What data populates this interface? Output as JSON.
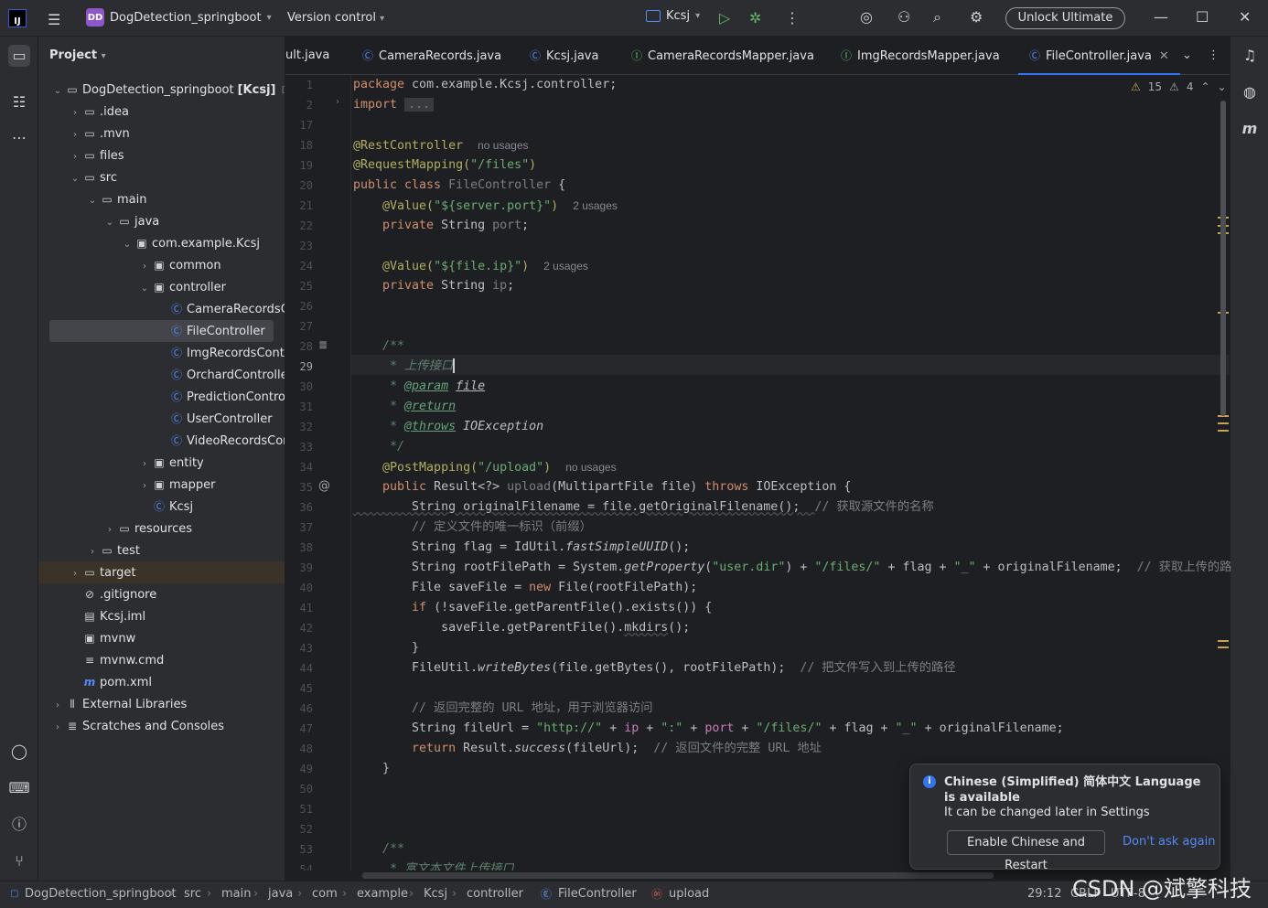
{
  "titlebar": {
    "logo": "IJ",
    "project_badge": "DD",
    "project_name": "DogDetection_springboot",
    "version_control": "Version control",
    "run_config": "Kcsj",
    "unlock": "Unlock Ultimate"
  },
  "project_panel": {
    "title": "Project",
    "tree": [
      {
        "label": "DogDetection_springboot",
        "extra": "[Kcsj]",
        "path": "D:\\I",
        "indent": 0,
        "arrow": "down",
        "icon": "module"
      },
      {
        "label": ".idea",
        "indent": 1,
        "arrow": "right",
        "icon": "folder"
      },
      {
        "label": ".mvn",
        "indent": 1,
        "arrow": "right",
        "icon": "folder"
      },
      {
        "label": "files",
        "indent": 1,
        "arrow": "right",
        "icon": "folder"
      },
      {
        "label": "src",
        "indent": 1,
        "arrow": "down",
        "icon": "folder"
      },
      {
        "label": "main",
        "indent": 2,
        "arrow": "down",
        "icon": "folder"
      },
      {
        "label": "java",
        "indent": 3,
        "arrow": "down",
        "icon": "folder"
      },
      {
        "label": "com.example.Kcsj",
        "indent": 4,
        "arrow": "down",
        "icon": "package"
      },
      {
        "label": "common",
        "indent": 5,
        "arrow": "right",
        "icon": "package"
      },
      {
        "label": "controller",
        "indent": 5,
        "arrow": "down",
        "icon": "package"
      },
      {
        "label": "CameraRecordsController",
        "indent": 6,
        "arrow": "",
        "icon": "class"
      },
      {
        "label": "FileController",
        "indent": 6,
        "arrow": "",
        "icon": "class",
        "selected": true
      },
      {
        "label": "ImgRecordsController",
        "indent": 6,
        "arrow": "",
        "icon": "class"
      },
      {
        "label": "OrchardController",
        "indent": 6,
        "arrow": "",
        "icon": "class"
      },
      {
        "label": "PredictionController",
        "indent": 6,
        "arrow": "",
        "icon": "class"
      },
      {
        "label": "UserController",
        "indent": 6,
        "arrow": "",
        "icon": "class"
      },
      {
        "label": "VideoRecordsController",
        "indent": 6,
        "arrow": "",
        "icon": "class"
      },
      {
        "label": "entity",
        "indent": 5,
        "arrow": "right",
        "icon": "package"
      },
      {
        "label": "mapper",
        "indent": 5,
        "arrow": "right",
        "icon": "package"
      },
      {
        "label": "Kcsj",
        "indent": 5,
        "arrow": "",
        "icon": "class"
      },
      {
        "label": "resources",
        "indent": 3,
        "arrow": "right",
        "icon": "folder"
      },
      {
        "label": "test",
        "indent": 2,
        "arrow": "right",
        "icon": "folder"
      },
      {
        "label": "target",
        "indent": 1,
        "arrow": "right",
        "icon": "folder-excluded",
        "highlight": true
      },
      {
        "label": ".gitignore",
        "indent": 1,
        "arrow": "",
        "icon": "ignore"
      },
      {
        "label": "Kcsj.iml",
        "indent": 1,
        "arrow": "",
        "icon": "file"
      },
      {
        "label": "mvnw",
        "indent": 1,
        "arrow": "",
        "icon": "terminal"
      },
      {
        "label": "mvnw.cmd",
        "indent": 1,
        "arrow": "",
        "icon": "lines"
      },
      {
        "label": "pom.xml",
        "indent": 1,
        "arrow": "",
        "icon": "maven"
      },
      {
        "label": "External Libraries",
        "indent": 0,
        "arrow": "right",
        "icon": "library"
      },
      {
        "label": "Scratches and Consoles",
        "indent": 0,
        "arrow": "right",
        "icon": "scratch"
      }
    ]
  },
  "tabs": [
    {
      "label": "ult.java",
      "icon": ""
    },
    {
      "label": "CameraRecords.java",
      "icon": "class"
    },
    {
      "label": "Kcsj.java",
      "icon": "class"
    },
    {
      "label": "CameraRecordsMapper.java",
      "icon": "interface"
    },
    {
      "label": "ImgRecordsMapper.java",
      "icon": "interface"
    },
    {
      "label": "FileController.java",
      "icon": "class",
      "active": true
    }
  ],
  "inspections": {
    "warnings": "15",
    "weak_warnings": "4"
  },
  "line_numbers": [
    "1",
    "2",
    "17",
    "18",
    "19",
    "20",
    "21",
    "22",
    "23",
    "24",
    "25",
    "26",
    "27",
    "28",
    "29",
    "30",
    "31",
    "32",
    "33",
    "34",
    "35",
    "36",
    "37",
    "38",
    "39",
    "40",
    "41",
    "42",
    "43",
    "44",
    "45",
    "46",
    "47",
    "48",
    "49",
    "50",
    "51",
    "52",
    "53",
    "54"
  ],
  "code": {
    "l1_pkg": "package",
    "l1_rest": " com.example.Kcsj.controller;",
    "l2_imp": "import",
    "l2_rest": "...",
    "l18": "@RestController",
    "l18_hint": "no usages",
    "l19_a": "@RequestMapping(",
    "l19_s": "\"/files\"",
    "l19_b": ")",
    "l20_kw": "public class",
    "l20_name": " FileController",
    "l20_b": " {",
    "l21_a": "    @Value(",
    "l21_s": "\"${server.port}\"",
    "l21_b": ")",
    "l21_hint": "2 usages",
    "l22_kw": "    private",
    "l22_t": " String ",
    "l22_f": "port",
    "l22_e": ";",
    "l24_a": "    @Value(",
    "l24_s": "\"${file.ip}\"",
    "l24_b": ")",
    "l24_hint": "2 usages",
    "l25_kw": "    private",
    "l25_t": " String ",
    "l25_f": "ip",
    "l25_e": ";",
    "l28": "    /**",
    "l29": "     * 上传接口",
    "l30_a": "     * ",
    "l30_tag": "@param",
    "l30_b": " ",
    "l30_p": "file",
    "l31_a": "     * ",
    "l31_tag": "@return",
    "l32_a": "     * ",
    "l32_tag": "@throws",
    "l32_b": " IOException",
    "l33": "     */",
    "l34_a": "    @PostMapping(",
    "l34_s": "\"/upload\"",
    "l34_b": ")",
    "l34_hint": "no usages",
    "l35_kw": "    public",
    "l35_a": " Result<?> ",
    "l35_m": "upload",
    "l35_b": "(MultipartFile file) ",
    "l35_kw2": "throws",
    "l35_c": " IOException {",
    "l36_a": "        String originalFilename = file.getOriginalFilename();  ",
    "l36_c": "// 获取源文件的名称",
    "l37": "        // 定义文件的唯一标识（前缀）",
    "l38_a": "        String flag = IdUtil.",
    "l38_i": "fastSimpleUUID",
    "l38_b": "();",
    "l39_a": "        String rootFilePath = System.",
    "l39_i": "getProperty",
    "l39_b": "(",
    "l39_s1": "\"user.dir\"",
    "l39_c": ") + ",
    "l39_s2": "\"/files/\"",
    "l39_d": " + flag + ",
    "l39_s3": "\"_\"",
    "l39_e": " + originalFilename;  ",
    "l39_cm": "// 获取上传的路",
    "l40_a": "        File saveFile = ",
    "l40_kw": "new",
    "l40_b": " File(rootFilePath);",
    "l41_kw": "        if",
    "l41_b": " (!saveFile.getParentFile().exists()) {",
    "l42_a": "            saveFile.getParentFile().",
    "l42_u": "mkdirs",
    "l42_b": "();",
    "l43": "        }",
    "l44_a": "        FileUtil.",
    "l44_i": "writeBytes",
    "l44_b": "(file.getBytes(), rootFilePath);  ",
    "l44_c": "// 把文件写入到上传的路径",
    "l46": "        // 返回完整的 URL 地址，用于浏览器访问",
    "l47_a": "        String fileUrl = ",
    "l47_s1": "\"http://\"",
    "l47_b": " + ",
    "l47_f1": "ip",
    "l47_c": " + ",
    "l47_s2": "\":\"",
    "l47_d": " + ",
    "l47_f2": "port",
    "l47_e": " + ",
    "l47_s3": "\"/files/\"",
    "l47_g": " + flag + ",
    "l47_s4": "\"_\"",
    "l47_h": " + originalFilename;",
    "l48_kw": "        return",
    "l48_a": " Result.",
    "l48_i": "success",
    "l48_b": "(fileUrl);  ",
    "l48_c": "// 返回文件的完整 URL 地址",
    "l49": "    }",
    "l53": "    /**",
    "l54": "     * 富文本文件上传接口"
  },
  "statusbar": {
    "crumbs": [
      "DogDetection_springboot",
      "src",
      "main",
      "java",
      "com",
      "example",
      "Kcsj",
      "controller",
      "FileController",
      "upload"
    ],
    "position": "29:12",
    "line_sep": "CRLF",
    "encoding": "UTF-8"
  },
  "toast": {
    "title": "Chinese (Simplified) 简体中文 Language is available",
    "subtitle": "It can be changed later in Settings",
    "button": "Enable Chinese and Restart",
    "link": "Don't ask again"
  },
  "watermark": "CSDN @斌擎科技",
  "colors": {
    "accent": "#3574f0",
    "keyword": "#cf8e6d",
    "string": "#6aab73",
    "annotation": "#b3ae60",
    "field": "#c77dbb"
  }
}
